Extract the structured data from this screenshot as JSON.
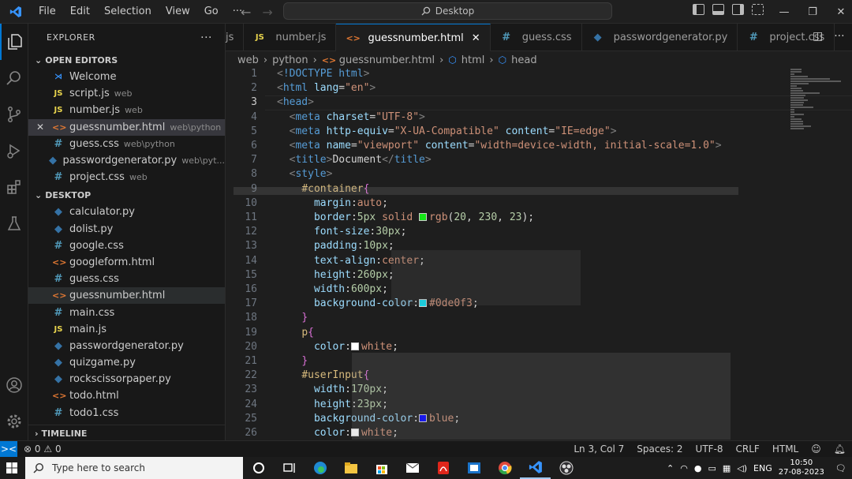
{
  "menu": [
    "File",
    "Edit",
    "Selection",
    "View",
    "Go",
    "···"
  ],
  "command_center": {
    "label": "Desktop"
  },
  "explorer": {
    "title": "EXPLORER",
    "more": "···"
  },
  "open_editors": {
    "title": "OPEN EDITORS",
    "items": [
      {
        "icon": "vscode-icon",
        "name": "Welcome",
        "dir": ""
      },
      {
        "icon": "JS",
        "name": "script.js",
        "dir": "web"
      },
      {
        "icon": "JS",
        "name": "number.js",
        "dir": "web"
      },
      {
        "icon": "<>",
        "name": "guessnumber.html",
        "dir": "web\\python"
      },
      {
        "icon": "#",
        "name": "guess.css",
        "dir": "web\\python"
      },
      {
        "icon": "py",
        "name": "passwordgenerator.py",
        "dir": "web\\pyt..."
      },
      {
        "icon": "#",
        "name": "project.css",
        "dir": "web"
      }
    ]
  },
  "desktop": {
    "title": "DESKTOP",
    "items": [
      {
        "icon": "py",
        "name": "calculator.py"
      },
      {
        "icon": "py",
        "name": "dolist.py"
      },
      {
        "icon": "#",
        "name": "google.css"
      },
      {
        "icon": "<>",
        "name": "googleform.html"
      },
      {
        "icon": "#",
        "name": "guess.css"
      },
      {
        "icon": "<>",
        "name": "guessnumber.html"
      },
      {
        "icon": "#",
        "name": "main.css"
      },
      {
        "icon": "JS",
        "name": "main.js"
      },
      {
        "icon": "py",
        "name": "passwordgenerator.py"
      },
      {
        "icon": "py",
        "name": "quizgame.py"
      },
      {
        "icon": "py",
        "name": "rockscissorpaper.py"
      },
      {
        "icon": "<>",
        "name": "todo.html"
      },
      {
        "icon": "#",
        "name": "todo1.css"
      }
    ]
  },
  "timeline": {
    "title": "TIMELINE"
  },
  "tabs": [
    {
      "icon": "",
      "label": "js"
    },
    {
      "icon": "JS",
      "label": "number.js"
    },
    {
      "icon": "<>",
      "label": "guessnumber.html",
      "close": "✕"
    },
    {
      "icon": "#",
      "label": "guess.css"
    },
    {
      "icon": "py",
      "label": "passwordgenerator.py"
    },
    {
      "icon": "#",
      "label": "project.css"
    }
  ],
  "breadcrumb": [
    "web",
    "python",
    "guessnumber.html",
    "html",
    "head"
  ],
  "editor": {
    "lines": [
      {
        "n": "1",
        "tokens": [
          [
            "t-br",
            "<"
          ],
          [
            "t-doc",
            "!DOCTYPE "
          ],
          [
            "t-tag",
            "html"
          ],
          [
            "t-br",
            ">"
          ]
        ]
      },
      {
        "n": "2",
        "tokens": [
          [
            "t-br",
            "<"
          ],
          [
            "t-tag",
            "html "
          ],
          [
            "t-attr",
            "lang"
          ],
          [
            "t-pun",
            "="
          ],
          [
            "t-str",
            "\"en\""
          ],
          [
            "t-br",
            ">"
          ]
        ]
      },
      {
        "n": "3",
        "tokens": [
          [
            "t-br",
            "<"
          ],
          [
            "t-tag",
            "head"
          ],
          [
            "t-br",
            ">"
          ]
        ]
      },
      {
        "n": "4",
        "tokens": [
          [
            "t-txt",
            "  "
          ],
          [
            "t-br",
            "<"
          ],
          [
            "t-tag",
            "meta "
          ],
          [
            "t-attr",
            "charset"
          ],
          [
            "t-pun",
            "="
          ],
          [
            "t-str",
            "\"UTF-8\""
          ],
          [
            "t-br",
            ">"
          ]
        ]
      },
      {
        "n": "5",
        "tokens": [
          [
            "t-txt",
            "  "
          ],
          [
            "t-br",
            "<"
          ],
          [
            "t-tag",
            "meta "
          ],
          [
            "t-attr",
            "http-equiv"
          ],
          [
            "t-pun",
            "="
          ],
          [
            "t-str",
            "\"X-UA-Compatible\" "
          ],
          [
            "t-attr",
            "content"
          ],
          [
            "t-pun",
            "="
          ],
          [
            "t-str",
            "\"IE=edge\""
          ],
          [
            "t-br",
            ">"
          ]
        ]
      },
      {
        "n": "6",
        "tokens": [
          [
            "t-txt",
            "  "
          ],
          [
            "t-br",
            "<"
          ],
          [
            "t-tag",
            "meta "
          ],
          [
            "t-attr",
            "name"
          ],
          [
            "t-pun",
            "="
          ],
          [
            "t-str",
            "\"viewport\" "
          ],
          [
            "t-attr",
            "content"
          ],
          [
            "t-pun",
            "="
          ],
          [
            "t-str",
            "\"width=device-width, initial-scale=1.0\""
          ],
          [
            "t-br",
            ">"
          ]
        ]
      },
      {
        "n": "7",
        "tokens": [
          [
            "t-txt",
            "  "
          ],
          [
            "t-br",
            "<"
          ],
          [
            "t-tag",
            "title"
          ],
          [
            "t-br",
            ">"
          ],
          [
            "t-txt",
            "Document"
          ],
          [
            "t-br",
            "</"
          ],
          [
            "t-tag",
            "title"
          ],
          [
            "t-br",
            ">"
          ]
        ]
      },
      {
        "n": "8",
        "tokens": [
          [
            "t-txt",
            "  "
          ],
          [
            "t-br",
            "<"
          ],
          [
            "t-tag",
            "style"
          ],
          [
            "t-br",
            ">"
          ]
        ]
      },
      {
        "n": "9",
        "tokens": [
          [
            "t-txt",
            "    "
          ],
          [
            "t-sel",
            "#container"
          ],
          [
            "t-brace",
            "{"
          ]
        ]
      },
      {
        "n": "10",
        "tokens": [
          [
            "t-txt",
            "      "
          ],
          [
            "t-prop",
            "margin"
          ],
          [
            "t-pun",
            ":"
          ],
          [
            "t-val",
            "auto"
          ],
          [
            "t-pun",
            ";"
          ]
        ]
      },
      {
        "n": "11",
        "tokens": [
          [
            "t-txt",
            "      "
          ],
          [
            "t-prop",
            "border"
          ],
          [
            "t-pun",
            ":"
          ],
          [
            "t-num",
            "5px "
          ],
          [
            "t-val",
            "solid "
          ],
          [
            "swatch",
            "#14e617"
          ],
          [
            "t-val",
            "rgb"
          ],
          [
            "t-pun",
            "("
          ],
          [
            "t-num",
            "20"
          ],
          [
            "t-pun",
            ", "
          ],
          [
            "t-num",
            "230"
          ],
          [
            "t-pun",
            ", "
          ],
          [
            "t-num",
            "23"
          ],
          [
            "t-pun",
            ");"
          ]
        ]
      },
      {
        "n": "12",
        "tokens": [
          [
            "t-txt",
            "      "
          ],
          [
            "t-prop",
            "font-size"
          ],
          [
            "t-pun",
            ":"
          ],
          [
            "t-num",
            "30px"
          ],
          [
            "t-pun",
            ";"
          ]
        ]
      },
      {
        "n": "13",
        "tokens": [
          [
            "t-txt",
            "      "
          ],
          [
            "t-prop",
            "padding"
          ],
          [
            "t-pun",
            ":"
          ],
          [
            "t-num",
            "10px"
          ],
          [
            "t-pun",
            ";"
          ]
        ]
      },
      {
        "n": "14",
        "tokens": [
          [
            "t-txt",
            "      "
          ],
          [
            "t-prop",
            "text-align"
          ],
          [
            "t-pun",
            ":"
          ],
          [
            "t-val",
            "center"
          ],
          [
            "t-pun",
            ";"
          ]
        ]
      },
      {
        "n": "15",
        "tokens": [
          [
            "t-txt",
            "      "
          ],
          [
            "t-prop",
            "height"
          ],
          [
            "t-pun",
            ":"
          ],
          [
            "t-num",
            "260px"
          ],
          [
            "t-pun",
            ";"
          ]
        ]
      },
      {
        "n": "16",
        "tokens": [
          [
            "t-txt",
            "      "
          ],
          [
            "t-prop",
            "width"
          ],
          [
            "t-pun",
            ":"
          ],
          [
            "t-num",
            "600px"
          ],
          [
            "t-pun",
            ";"
          ]
        ]
      },
      {
        "n": "17",
        "tokens": [
          [
            "t-txt",
            "      "
          ],
          [
            "t-prop",
            "background-color"
          ],
          [
            "t-pun",
            ":"
          ],
          [
            "swatch",
            "#0de0f3"
          ],
          [
            "t-val",
            "#0de0f3"
          ],
          [
            "t-pun",
            ";"
          ]
        ]
      },
      {
        "n": "18",
        "tokens": [
          [
            "t-txt",
            "    "
          ],
          [
            "t-brace",
            "}"
          ]
        ]
      },
      {
        "n": "19",
        "tokens": [
          [
            "t-txt",
            "    "
          ],
          [
            "t-sel",
            "p"
          ],
          [
            "t-brace",
            "{"
          ]
        ]
      },
      {
        "n": "20",
        "tokens": [
          [
            "t-txt",
            "      "
          ],
          [
            "t-prop",
            "color"
          ],
          [
            "t-pun",
            ":"
          ],
          [
            "swatch",
            "#ffffff"
          ],
          [
            "t-val",
            "white"
          ],
          [
            "t-pun",
            ";"
          ]
        ]
      },
      {
        "n": "21",
        "tokens": [
          [
            "t-txt",
            "    "
          ],
          [
            "t-brace",
            "}"
          ]
        ]
      },
      {
        "n": "22",
        "tokens": [
          [
            "t-txt",
            "    "
          ],
          [
            "t-sel",
            "#userInput"
          ],
          [
            "t-brace",
            "{"
          ]
        ]
      },
      {
        "n": "23",
        "tokens": [
          [
            "t-txt",
            "      "
          ],
          [
            "t-prop",
            "width"
          ],
          [
            "t-pun",
            ":"
          ],
          [
            "t-num",
            "170px"
          ],
          [
            "t-pun",
            ";"
          ]
        ]
      },
      {
        "n": "24",
        "tokens": [
          [
            "t-txt",
            "      "
          ],
          [
            "t-prop",
            "height"
          ],
          [
            "t-pun",
            ":"
          ],
          [
            "t-num",
            "23px"
          ],
          [
            "t-pun",
            ";"
          ]
        ]
      },
      {
        "n": "25",
        "tokens": [
          [
            "t-txt",
            "      "
          ],
          [
            "t-prop",
            "background-color"
          ],
          [
            "t-pun",
            ":"
          ],
          [
            "swatch",
            "#0000ff"
          ],
          [
            "t-val",
            "blue"
          ],
          [
            "t-pun",
            ";"
          ]
        ]
      },
      {
        "n": "26",
        "tokens": [
          [
            "t-txt",
            "      "
          ],
          [
            "t-prop",
            "color"
          ],
          [
            "t-pun",
            ":"
          ],
          [
            "swatch",
            "#ffffff"
          ],
          [
            "t-val",
            "white"
          ],
          [
            "t-pun",
            ";"
          ]
        ]
      }
    ],
    "current_line": "3"
  },
  "status": {
    "remote": "><",
    "errors": "0",
    "warnings": "0",
    "position": "Ln 3, Col 7",
    "spaces": "Spaces: 2",
    "encoding": "UTF-8",
    "eol": "CRLF",
    "language": "HTML"
  },
  "taskbar": {
    "search_placeholder": "Type here to search",
    "lang": "ENG",
    "time": "10:50",
    "date": "27-08-2023"
  },
  "colors": {
    "accent": "#0078d4",
    "js": "#e8d44d",
    "css": "#519aba",
    "html": "#e37933",
    "python": "#3572a5"
  }
}
